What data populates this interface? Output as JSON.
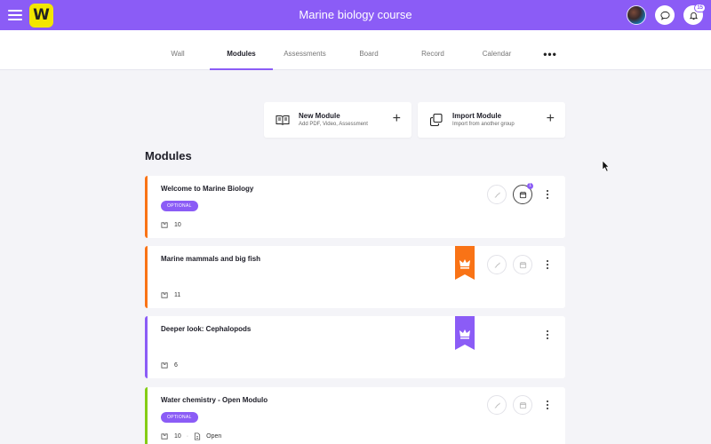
{
  "app": {
    "title": "Marine biology course",
    "logo_letter": "W",
    "notification_count": "15"
  },
  "tabs": [
    {
      "label": "Wall"
    },
    {
      "label": "Modules",
      "active": true
    },
    {
      "label": "Assessments"
    },
    {
      "label": "Board"
    },
    {
      "label": "Record"
    },
    {
      "label": "Calendar"
    }
  ],
  "more_label": "•••",
  "actions": {
    "new_module": {
      "title": "New Module",
      "subtitle": "Add PDF, Video, Assessment",
      "plus": "+"
    },
    "import_module": {
      "title": "Import Module",
      "subtitle": "Import from another group",
      "plus": "+"
    }
  },
  "section_title": "Modules",
  "modules": [
    {
      "title": "Welcome to Marine Biology",
      "tag": "OPTIONAL",
      "count": "10",
      "stripe_color": "#f97316",
      "calendar_badge": "1"
    },
    {
      "title": "Marine mammals and big fish",
      "count": "11",
      "stripe_color": "#f97316",
      "ribbon_color": "#f97316"
    },
    {
      "title": "Deeper look: Cephalopods",
      "count": "6",
      "stripe_color": "#8b5cf6",
      "ribbon_color": "#8b5cf6"
    },
    {
      "title": "Water chemistry - Open Modulo",
      "tag": "OPTIONAL",
      "count": "10",
      "status": "Open",
      "stripe_color": "#84cc16"
    }
  ],
  "colors": {
    "accent": "#8b5cf6",
    "logo": "#f2e600",
    "orange": "#f97316",
    "green": "#84cc16"
  },
  "icons": {
    "menu": "hamburger-icon",
    "chat": "chat-bubble-icon",
    "bell": "bell-icon",
    "book": "open-book-icon",
    "import": "copy-squares-icon",
    "path": "path-icon",
    "calendar": "calendar-icon",
    "crown": "crown-icon",
    "pieces": "puzzle-pieces-icon",
    "document": "document-icon"
  }
}
